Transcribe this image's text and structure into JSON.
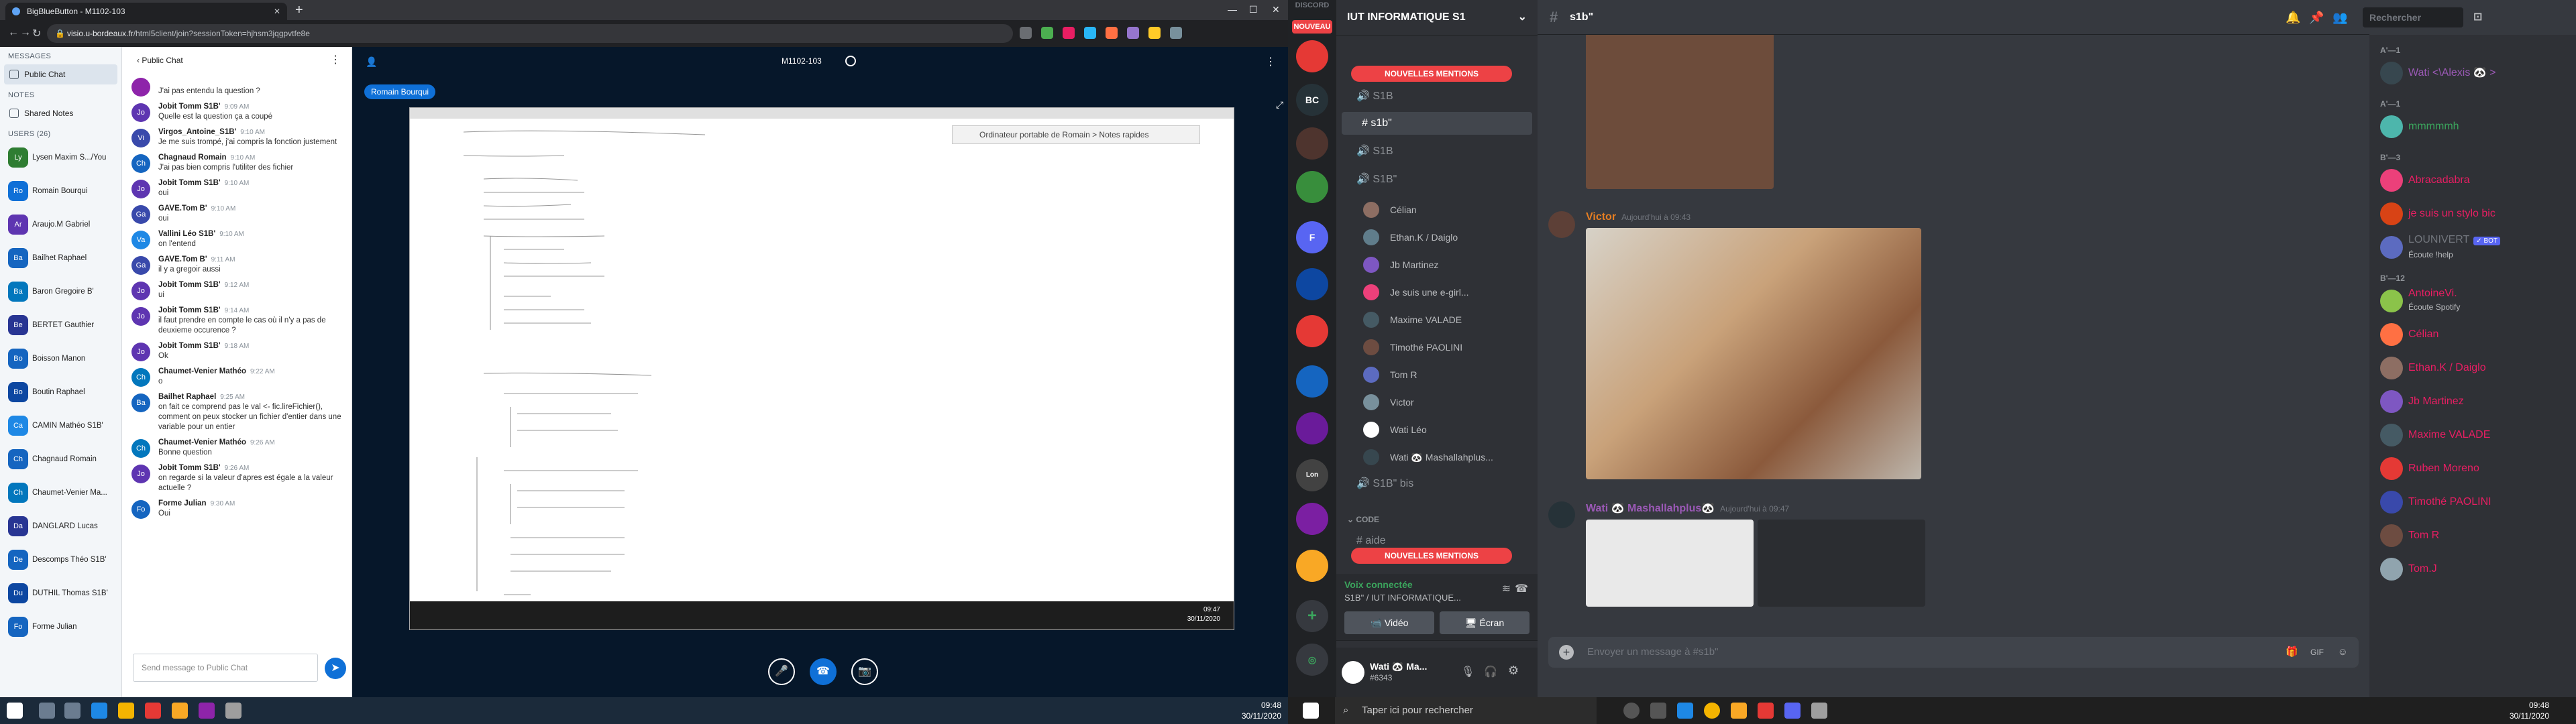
{
  "left": {
    "tab_title": "BigBlueButton - M1102-103",
    "url_host": "visio.u-bordeaux.fr",
    "url_rest": "/html5client/join?sessionToken=hjhsm3jqgpvtfe8e",
    "messages_header": "MESSAGES",
    "public_chat": "Public Chat",
    "notes_header": "NOTES",
    "shared_notes": "Shared Notes",
    "users_header": "USERS (26)",
    "users": [
      {
        "init": "Ly",
        "name": "Lysen Maxim S.../You",
        "color": "#2e7d32"
      },
      {
        "init": "Ro",
        "name": "Romain Bourqui",
        "color": "#0f70d7"
      },
      {
        "init": "Ar",
        "name": "Araujo.M Gabriel",
        "color": "#5e35b1"
      },
      {
        "init": "Ba",
        "name": "Bailhet Raphael",
        "color": "#1565c0"
      },
      {
        "init": "Ba",
        "name": "Baron Gregoire B'",
        "color": "#0277bd"
      },
      {
        "init": "Be",
        "name": "BERTET Gauthier",
        "color": "#283593"
      },
      {
        "init": "Bo",
        "name": "Boisson Manon",
        "color": "#1565c0"
      },
      {
        "init": "Bo",
        "name": "Boutin Raphael",
        "color": "#0d47a1"
      },
      {
        "init": "Ca",
        "name": "CAMIN Mathéo S1B'",
        "color": "#1e88e5"
      },
      {
        "init": "Ch",
        "name": "Chagnaud Romain",
        "color": "#1565c0"
      },
      {
        "init": "Ch",
        "name": "Chaumet-Venier Ma...",
        "color": "#0277bd"
      },
      {
        "init": "Da",
        "name": "DANGLARD Lucas",
        "color": "#283593"
      },
      {
        "init": "De",
        "name": "Descomps Théo S1B'",
        "color": "#1565c0"
      },
      {
        "init": "Du",
        "name": "DUTHIL Thomas S1B'",
        "color": "#0d47a1"
      },
      {
        "init": "Fo",
        "name": "Forme Julian",
        "color": "#1565c0"
      }
    ],
    "chat_title": "Public Chat",
    "messages": [
      {
        "init": "",
        "name": "",
        "time": "",
        "text": "J'ai pas entendu la question ?",
        "color": "#8e24aa"
      },
      {
        "init": "Jo",
        "name": "Jobit Tomm S1B'",
        "time": "9:09 AM",
        "text": "Quelle est la question ça a coupé",
        "color": "#5e35b1"
      },
      {
        "init": "Vi",
        "name": "Virgos_Antoine_S1B'",
        "time": "9:10 AM",
        "text": "Je me suis trompé, j'ai compris la fonction justement",
        "color": "#3949ab"
      },
      {
        "init": "Ch",
        "name": "Chagnaud Romain",
        "time": "9:10 AM",
        "text": "J'ai pas bien compris l'utiliter des fichier",
        "color": "#1565c0"
      },
      {
        "init": "Jo",
        "name": "Jobit Tomm S1B'",
        "time": "9:10 AM",
        "text": "oui",
        "color": "#5e35b1"
      },
      {
        "init": "Ga",
        "name": "GAVE.Tom B'",
        "time": "9:10 AM",
        "text": "oui",
        "color": "#3949ab"
      },
      {
        "init": "Va",
        "name": "Vallini Léo S1B'",
        "time": "9:10 AM",
        "text": "on l'entend",
        "color": "#1e88e5"
      },
      {
        "init": "Ga",
        "name": "GAVE.Tom B'",
        "time": "9:11 AM",
        "text": "il y a gregoir aussi",
        "color": "#3949ab"
      },
      {
        "init": "Jo",
        "name": "Jobit Tomm S1B'",
        "time": "9:12 AM",
        "text": "ui",
        "color": "#5e35b1"
      },
      {
        "init": "Jo",
        "name": "Jobit Tomm S1B'",
        "time": "9:14 AM",
        "text": "il faut prendre en compte le cas où il n'y a pas de deuxieme occurence ?",
        "color": "#5e35b1"
      },
      {
        "init": "Jo",
        "name": "Jobit Tomm S1B'",
        "time": "9:18 AM",
        "text": "Ok",
        "color": "#5e35b1"
      },
      {
        "init": "Ch",
        "name": "Chaumet-Venier Mathéo",
        "time": "9:22 AM",
        "text": "o",
        "color": "#0277bd"
      },
      {
        "init": "Ba",
        "name": "Bailhet Raphael",
        "time": "9:25 AM",
        "text": "on fait ce comprend pas le val <- fic.lireFichier(), comment on peux stocker un fichier d'entier dans une variable pour un entier",
        "color": "#1565c0"
      },
      {
        "init": "Ch",
        "name": "Chaumet-Venier Mathéo",
        "time": "9:26 AM",
        "text": "Bonne question",
        "color": "#0277bd"
      },
      {
        "init": "Jo",
        "name": "Jobit Tomm S1B'",
        "time": "9:26 AM",
        "text": "on regarde si la valeur d'apres est égale a la valeur actuelle ?",
        "color": "#5e35b1"
      },
      {
        "init": "Fo",
        "name": "Forme Julian",
        "time": "9:30 AM",
        "text": "Oui",
        "color": "#1565c0"
      }
    ],
    "chat_placeholder": "Send message to Public Chat",
    "room_name": "M1102-103",
    "presenter": "Romain Bourqui",
    "notes_window": "Ordinateur portable de Romain > Notes rapides",
    "slide_clock_time": "09:47",
    "slide_clock_date": "30/11/2020",
    "clock_time": "09:48",
    "clock_date": "30/11/2020"
  },
  "discord": {
    "logo": "DISCORD",
    "nouveau": "NOUVEAU",
    "server_name": "IUT INFORMATIQUE S1",
    "mention_label": "NOUVELLES MENTIONS",
    "channels": [
      "S1B",
      "s1b\"",
      "S1B",
      "S1B\""
    ],
    "members_in_voice": [
      "Célian",
      "Ethan.K / Daiglo",
      "Jb Martinez",
      "Je suis une e-girl...",
      "Maxime VALADE",
      "Timothé PAOLINI",
      "Tom R",
      "Victor",
      "Wati Léo",
      "Wati 🐼 Mashallahplus..."
    ],
    "channel_bis": "S1B\" bis",
    "code_cat": "CODE",
    "aide": "aide",
    "voice_connected": "Voix connectée",
    "voice_where": "S1B\" / IUT INFORMATIQUE...",
    "video_btn": "Vidéo",
    "screen_btn": "Écran",
    "username": "Wati 🐼 Ma...",
    "discriminator": "#6343",
    "current_channel": "s1b\"",
    "search_placeholder": "Rechercher",
    "msg1_author": "Victor",
    "msg1_time": "Aujourd'hui à 09:43",
    "msg2_author": "Wati 🐼 Mashallahplus🐼",
    "msg2_time": "Aujourd'hui à 09:47",
    "composer_placeholder": "Envoyer un message à #s1b\"",
    "members": [
      {
        "cat": "A'—1",
        "name": "Wati <\\Alexis 🐼 >",
        "sub": "",
        "color": "#9b59b6"
      },
      {
        "cat": "A'—1",
        "name": "mmmmmh",
        "sub": "",
        "color": "#3ba55d"
      },
      {
        "cat": "B'—3",
        "name": "Abracadabra",
        "sub": "",
        "color": "#e91e63"
      },
      {
        "cat": "",
        "name": "je suis un stylo bic",
        "sub": "",
        "color": "#e91e63"
      },
      {
        "cat": "",
        "name": "LOUNIVERT",
        "sub": "Écoute !help",
        "color": "#72767d"
      },
      {
        "cat": "B'—12",
        "name": "AntoineVi.",
        "sub": "Écoute Spotify",
        "color": "#e91e63"
      },
      {
        "cat": "",
        "name": "Célian",
        "sub": "",
        "color": "#e91e63"
      },
      {
        "cat": "",
        "name": "Ethan.K / Daiglo",
        "sub": "",
        "color": "#e91e63"
      },
      {
        "cat": "",
        "name": "Jb Martinez",
        "sub": "",
        "color": "#e91e63"
      },
      {
        "cat": "",
        "name": "Maxime VALADE",
        "sub": "",
        "color": "#e91e63"
      },
      {
        "cat": "",
        "name": "Ruben Moreno",
        "sub": "",
        "color": "#e91e63"
      },
      {
        "cat": "",
        "name": "Timothé PAOLINI",
        "sub": "",
        "color": "#e91e63"
      },
      {
        "cat": "",
        "name": "Tom R",
        "sub": "",
        "color": "#e91e63"
      },
      {
        "cat": "",
        "name": "Tom.J",
        "sub": "",
        "color": "#e91e63"
      }
    ],
    "bot_tag": "✓ BOT",
    "taskbar_search": "Taper ici pour rechercher",
    "clock_time": "09:48",
    "clock_date": "30/11/2020"
  }
}
